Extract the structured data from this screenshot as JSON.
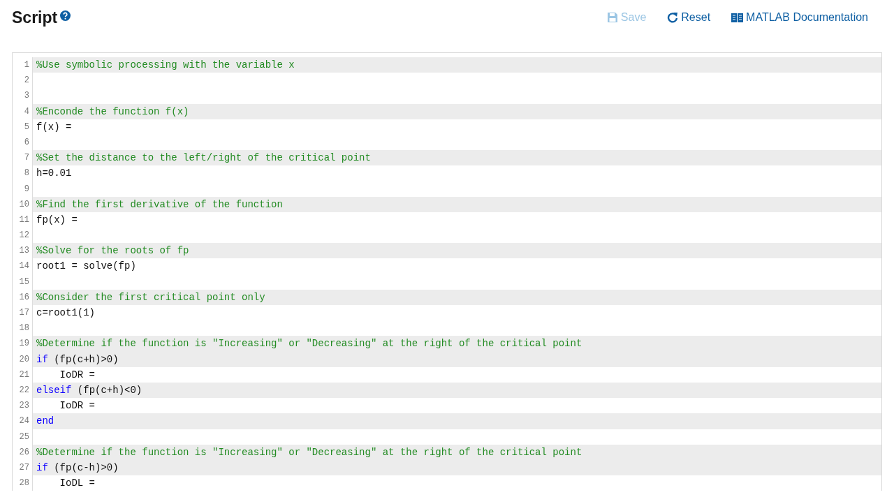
{
  "header": {
    "title": "Script",
    "actions": [
      {
        "kind": "save",
        "label": "Save",
        "disabled": true
      },
      {
        "kind": "reset",
        "label": "Reset",
        "disabled": false
      },
      {
        "kind": "docs",
        "label": "MATLAB Documentation",
        "disabled": false
      }
    ]
  },
  "editor": {
    "lines": [
      {
        "number": "1",
        "locked": true,
        "tokens": [
          {
            "kind": "comment",
            "text": "%Use symbolic processing with the variable x"
          }
        ]
      },
      {
        "number": "2"
      },
      {
        "number": "3"
      },
      {
        "number": "4",
        "locked": true,
        "tokens": [
          {
            "kind": "comment",
            "text": "%Enconde the function f(x)"
          }
        ]
      },
      {
        "number": "5",
        "locked": false,
        "tokens": [
          {
            "kind": "plain",
            "text": "f(x) ="
          }
        ]
      },
      {
        "number": "6"
      },
      {
        "number": "7",
        "locked": true,
        "tokens": [
          {
            "kind": "comment",
            "text": "%Set the distance to the left/right of the critical point"
          }
        ]
      },
      {
        "number": "8",
        "locked": false,
        "tokens": [
          {
            "kind": "plain",
            "text": "h=0.01"
          }
        ]
      },
      {
        "number": "9"
      },
      {
        "number": "10",
        "locked": true,
        "tokens": [
          {
            "kind": "comment",
            "text": "%Find the first derivative of the function"
          }
        ]
      },
      {
        "number": "11",
        "locked": false,
        "tokens": [
          {
            "kind": "plain",
            "text": "fp(x) ="
          }
        ]
      },
      {
        "number": "12"
      },
      {
        "number": "13",
        "locked": true,
        "tokens": [
          {
            "kind": "comment",
            "text": "%Solve for the roots of fp"
          }
        ]
      },
      {
        "number": "14",
        "locked": false,
        "tokens": [
          {
            "kind": "plain",
            "text": "root1 = solve(fp)"
          }
        ]
      },
      {
        "number": "15"
      },
      {
        "number": "16",
        "locked": true,
        "tokens": [
          {
            "kind": "comment",
            "text": "%Consider the first critical point only"
          }
        ]
      },
      {
        "number": "17",
        "locked": false,
        "tokens": [
          {
            "kind": "plain",
            "text": "c=root1(1)"
          }
        ]
      },
      {
        "number": "18"
      },
      {
        "number": "19",
        "locked": true,
        "tokens": [
          {
            "kind": "comment",
            "text": "%Determine if the function is \"Increasing\" or \"Decreasing\" at the right of the critical point"
          }
        ]
      },
      {
        "number": "20",
        "locked": true,
        "tokens": [
          {
            "kind": "keyword",
            "text": "if"
          },
          {
            "kind": "plain",
            "text": " (fp(c+h)>0)"
          }
        ]
      },
      {
        "number": "21",
        "locked": false,
        "tokens": [
          {
            "kind": "plain",
            "text": "    IoDR ="
          }
        ]
      },
      {
        "number": "22",
        "locked": true,
        "tokens": [
          {
            "kind": "keyword",
            "text": "elseif"
          },
          {
            "kind": "plain",
            "text": " (fp(c+h)<0)"
          }
        ]
      },
      {
        "number": "23",
        "locked": false,
        "tokens": [
          {
            "kind": "plain",
            "text": "    IoDR ="
          }
        ]
      },
      {
        "number": "24",
        "locked": true,
        "tokens": [
          {
            "kind": "keyword",
            "text": "end"
          }
        ]
      },
      {
        "number": "25"
      },
      {
        "number": "26",
        "locked": true,
        "tokens": [
          {
            "kind": "comment",
            "text": "%Determine if the function is \"Increasing\" or \"Decreasing\" at the right of the critical point"
          }
        ]
      },
      {
        "number": "27",
        "locked": true,
        "tokens": [
          {
            "kind": "keyword",
            "text": "if"
          },
          {
            "kind": "plain",
            "text": " (fp(c-h)>0)"
          }
        ]
      },
      {
        "number": "28",
        "locked": false,
        "tokens": [
          {
            "kind": "plain",
            "text": "    IoDL ="
          }
        ]
      }
    ]
  }
}
